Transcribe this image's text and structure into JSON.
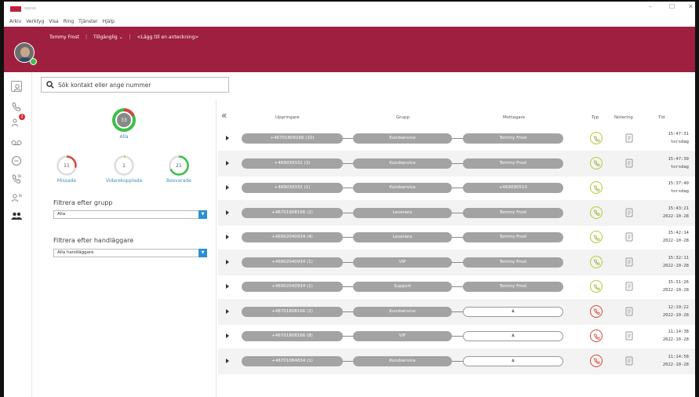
{
  "app": {
    "title": "xxxxx",
    "logo_color": "#c0213a"
  },
  "window": {
    "minimize": "–",
    "maximize": "☐",
    "close": "✕"
  },
  "menu": [
    "Arkiv",
    "Verktyg",
    "Visa",
    "Ring",
    "Tjänster",
    "Hjälp"
  ],
  "user": {
    "name": "Tommy Frost",
    "status": "Tillgänglig ⌄",
    "note_prompt": "<Lägg till en anteckning>",
    "presence_color": "#3bbf48"
  },
  "brand": {
    "bar_color": "#9e1f40"
  },
  "rail": {
    "voicemail_badge": "2"
  },
  "search": {
    "placeholder": "Sök kontakt eller ange nummer"
  },
  "stats": {
    "all": {
      "value": "33",
      "label": "Alla"
    },
    "missed": {
      "value": "11",
      "label": "Missade"
    },
    "forwarded": {
      "value": "1",
      "label": "Vidarekopplade"
    },
    "answered": {
      "value": "21",
      "label": "Besvarade"
    }
  },
  "filters": {
    "group": {
      "label": "Filtrera efter grupp",
      "value": "Alla"
    },
    "handler": {
      "label": "Filtrera efter handläggare",
      "value": "Alla handläggare"
    }
  },
  "columns": {
    "caller": "Uppringare",
    "group": "Grupp",
    "receiver": "Mottagare",
    "type": "Typ",
    "note": "Notering",
    "time": "Tid"
  },
  "calls": [
    {
      "caller": "+46701808166 (10)",
      "group": "Kundservice",
      "receiver": "Tommy Frost",
      "type": "answered",
      "note": true,
      "time": "15:47:31",
      "date": "torsdag"
    },
    {
      "caller": "+469030332 (3)",
      "group": "Kundservice",
      "receiver": "Tommy Frost",
      "type": "answered",
      "note": true,
      "time": "15:47:39",
      "date": "torsdag"
    },
    {
      "caller": "+469030332 (1)",
      "group": "Kundservice",
      "receiver": "+469090510",
      "type": "answered",
      "note": false,
      "time": "15:37:40",
      "date": "torsdag"
    },
    {
      "caller": "+46701908166 (2)",
      "group": "Leverans",
      "receiver": "Tommy Frost",
      "type": "answered",
      "note": true,
      "time": "15:43:21",
      "date": "2022-10-28"
    },
    {
      "caller": "+46902040934 (4)",
      "group": "Leverans",
      "receiver": "Tommy Frost",
      "type": "answered",
      "note": true,
      "time": "15:42:14",
      "date": "2022-10-28"
    },
    {
      "caller": "+46902040934 (1)",
      "group": "VIP",
      "receiver": "Tommy Frost",
      "type": "answered",
      "note": true,
      "time": "15:32:11",
      "date": "2022-10-28"
    },
    {
      "caller": "+46902040934 (1)",
      "group": "Support",
      "receiver": "Tommy Frost",
      "type": "answered",
      "note": true,
      "time": "15:31:26",
      "date": "2022-10-28"
    },
    {
      "caller": "+46701808166 (2)",
      "group": "Kundservice",
      "receiver": "",
      "type": "missed",
      "note": true,
      "time": "12:19:22",
      "date": "2022-10-28"
    },
    {
      "caller": "+46701808166 (8)",
      "group": "VIP",
      "receiver": "",
      "type": "missed",
      "note": true,
      "time": "11:14:38",
      "date": "2022-10-28"
    },
    {
      "caller": "+46701084834 (1)",
      "group": "Kundservice",
      "receiver": "",
      "type": "missed",
      "note": true,
      "time": "11:14:58",
      "date": "2022-10-28"
    }
  ]
}
